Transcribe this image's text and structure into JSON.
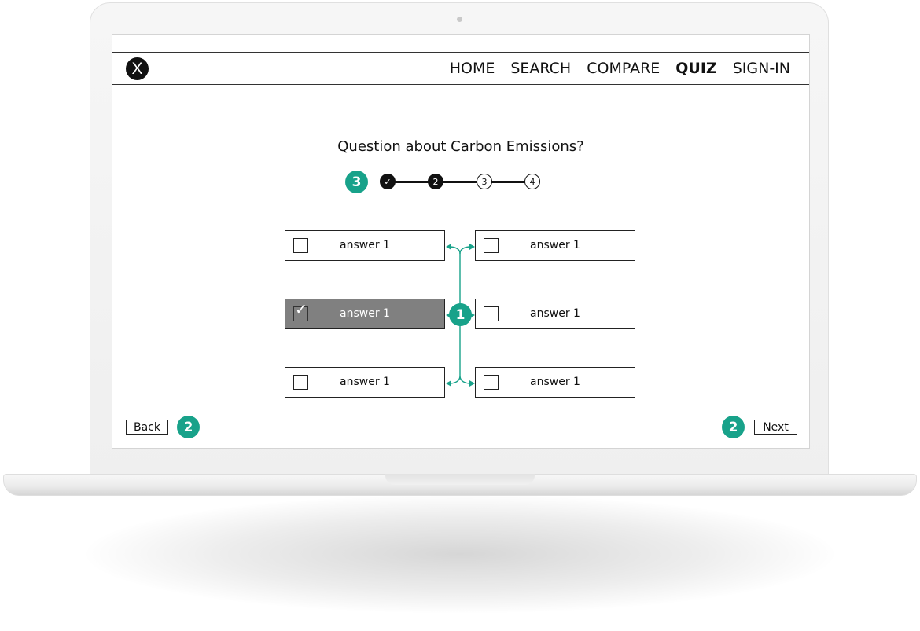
{
  "logo": {
    "text": "X"
  },
  "nav": {
    "items": [
      {
        "label": "HOME",
        "active": false
      },
      {
        "label": "SEARCH",
        "active": false
      },
      {
        "label": "COMPARE",
        "active": false
      },
      {
        "label": "QUIZ",
        "active": true
      },
      {
        "label": "SIGN-IN",
        "active": false
      }
    ]
  },
  "quiz": {
    "question": "Question about Carbon Emissions?",
    "steps": [
      {
        "label": "✓",
        "state": "done"
      },
      {
        "label": "2",
        "state": "current"
      },
      {
        "label": "3",
        "state": "todo"
      },
      {
        "label": "4",
        "state": "todo"
      }
    ],
    "answers": [
      {
        "label": "answer 1",
        "selected": false
      },
      {
        "label": "answer 1",
        "selected": false
      },
      {
        "label": "answer 1",
        "selected": true
      },
      {
        "label": "answer 1",
        "selected": false
      },
      {
        "label": "answer 1",
        "selected": false
      },
      {
        "label": "answer 1",
        "selected": false
      }
    ],
    "back_label": "Back",
    "next_label": "Next"
  },
  "annotations": {
    "progress_badge": "3",
    "answers_badge": "1",
    "back_badge": "2",
    "next_badge": "2"
  },
  "colors": {
    "annotation": "#18a28a",
    "selected_answer": "#808080"
  }
}
